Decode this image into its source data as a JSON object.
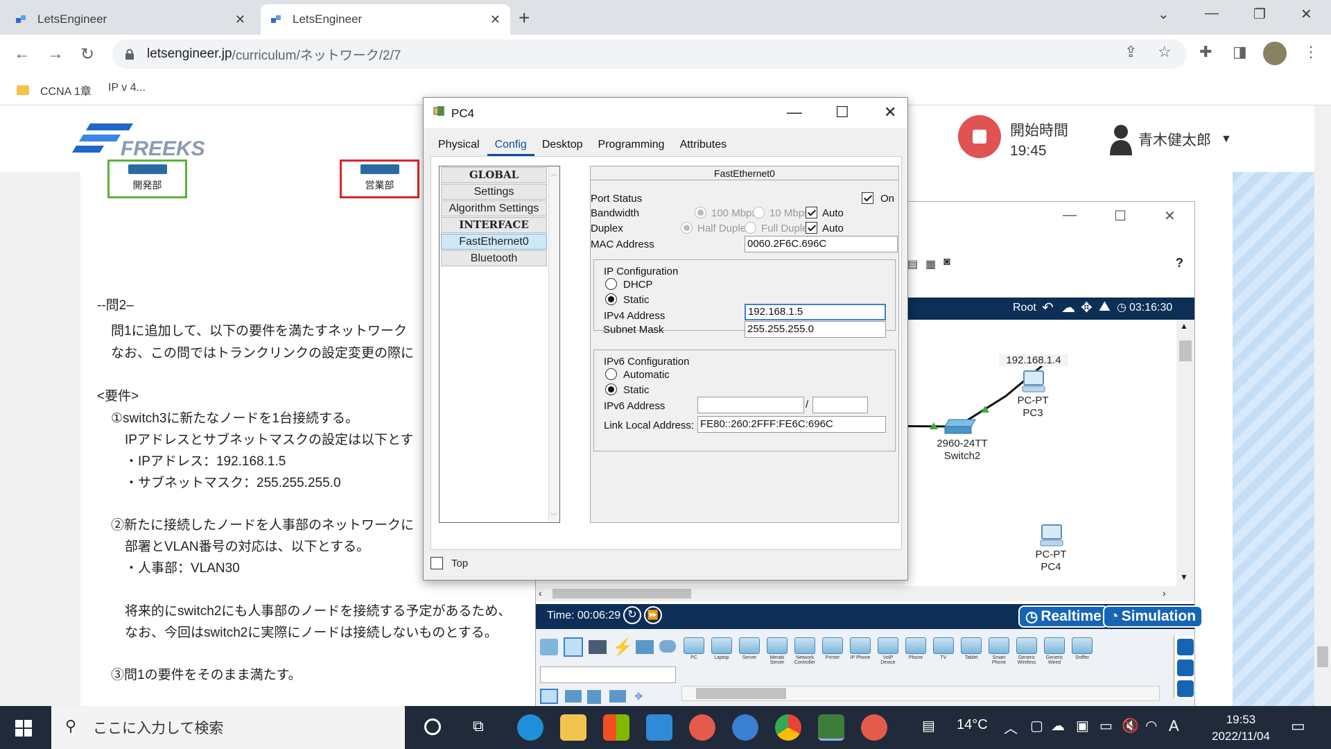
{
  "browser": {
    "tabs": [
      {
        "title": "LetsEngineer",
        "active": false
      },
      {
        "title": "LetsEngineer",
        "active": true
      }
    ],
    "url_host": "letsengineer.jp",
    "url_path": "/curriculum/ネットワーク/2/7",
    "bookmarks": [
      "CCNA 1章",
      "IP v 4..."
    ]
  },
  "site": {
    "logo_text": "FREEKS",
    "start_time_label": "開始時間",
    "start_time": "19:45",
    "user_name": "青木健太郎"
  },
  "lesson": {
    "dept_boxes": [
      {
        "label": "開発部",
        "color": "#59b33a"
      },
      {
        "label": "営業部",
        "color": "#d9252b"
      }
    ],
    "lines": [
      "--問2–",
      "問1に追加して、以下の要件を満たすネットワーク",
      "なお、この問ではトランクリンクの設定変更の際に",
      "<要件>",
      "①switch3に新たなノードを1台接続する。",
      "IPアドレスとサブネットマスクの設定は以下とす",
      "・IPアドレス：192.168.1.5",
      "・サブネットマスク：255.255.255.0",
      "②新たに接続したノードを人事部のネットワークに",
      "部署とVLAN番号の対応は、以下とする。",
      "・人事部：VLAN30",
      "将来的にswitch2にも人事部のノードを接続する予定があるため、",
      "なお、今回はswitch2に実際にノードは接続しないものとする。",
      "③問1の要件をそのまま満たす。"
    ]
  },
  "packet_tracer": {
    "help": "?",
    "root_label": "Root",
    "clock": "03:16:30",
    "time_label": "Time: 00:06:29",
    "realtime_label": "Realtime",
    "simulation_label": "Simulation",
    "nodes": [
      {
        "ip": "192.168.1.4",
        "type": "PC-PT",
        "name": "PC3"
      },
      {
        "model": "2960-24TT",
        "name": "Switch2"
      },
      {
        "type": "PC-PT",
        "name": "PC4"
      }
    ],
    "devices": [
      "PC",
      "Laptop",
      "Server",
      "Meraki Server",
      "Network Controller",
      "Printer",
      "IP Phone",
      "VoIP Device",
      "Phone",
      "TV",
      "Tablet",
      "Smart Phone",
      "Generic Wireless",
      "Generic Wired",
      "Sniffer"
    ]
  },
  "dialog": {
    "title": "PC4",
    "tabs": [
      "Physical",
      "Config",
      "Desktop",
      "Programming",
      "Attributes"
    ],
    "selected_tab": "Config",
    "left_items": [
      {
        "label": "GLOBAL",
        "header": true
      },
      {
        "label": "Settings"
      },
      {
        "label": "Algorithm Settings"
      },
      {
        "label": "INTERFACE",
        "header": true
      },
      {
        "label": "FastEthernet0",
        "selected": true
      },
      {
        "label": "Bluetooth"
      }
    ],
    "panel_title": "FastEthernet0",
    "port_status_label": "Port Status",
    "port_status_on": "On",
    "bandwidth_label": "Bandwidth",
    "bw_100": "100 Mbps",
    "bw_10": "10 Mbps",
    "duplex_label": "Duplex",
    "half_duplex": "Half Duplex",
    "full_duplex": "Full Duplex",
    "auto": "Auto",
    "mac_label": "MAC Address",
    "mac_value": "0060.2F6C.696C",
    "ip_config_title": "IP Configuration",
    "dhcp": "DHCP",
    "static": "Static",
    "ipv4_label": "IPv4 Address",
    "ipv4_value": "192.168.1.5",
    "mask_label": "Subnet Mask",
    "mask_value": "255.255.255.0",
    "ipv6_config_title": "IPv6 Configuration",
    "automatic": "Automatic",
    "ipv6_label": "IPv6 Address",
    "ipv6_value": "",
    "ipv6_prefix": "",
    "ipv6_slash": "/",
    "link_local_label": "Link Local Address:",
    "link_local_value": "FE80::260:2FFF:FE6C:696C",
    "top_label": "Top"
  },
  "taskbar": {
    "search_placeholder": "ここに入力して検索",
    "weather": "14°C",
    "ime": "A",
    "time": "19:53",
    "date": "2022/11/04"
  }
}
